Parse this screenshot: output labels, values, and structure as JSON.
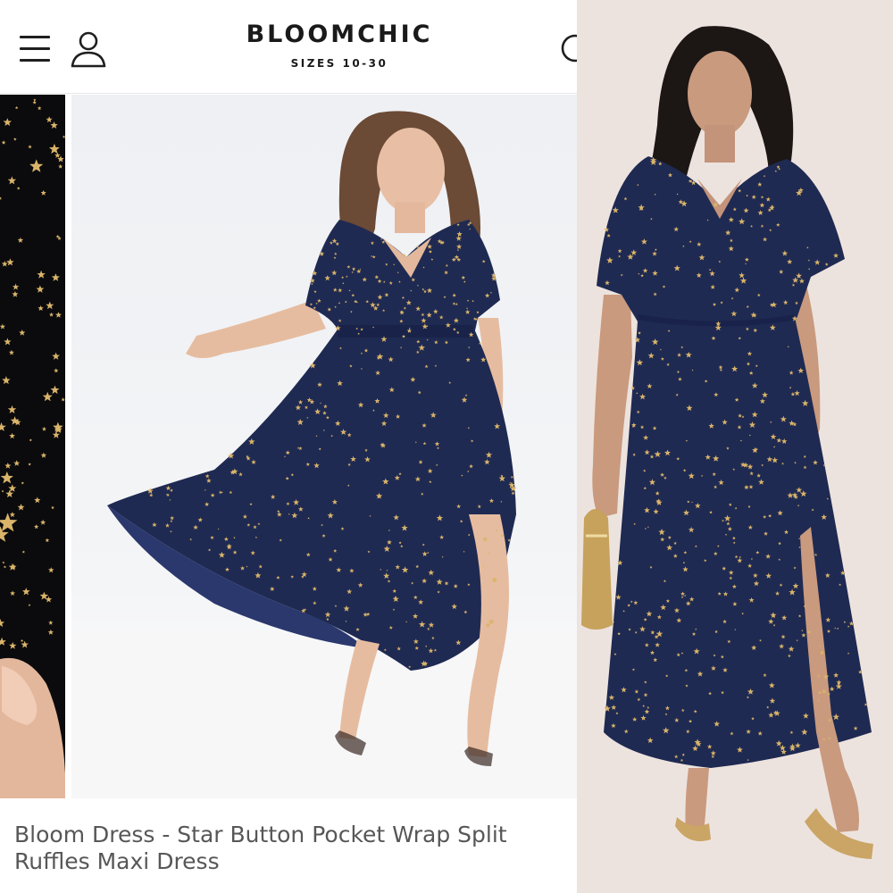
{
  "header": {
    "brand_name": "BLOOMCHIC",
    "brand_tagline": "SIZES 10-30",
    "menu_icon": "hamburger-menu-icon",
    "account_icon": "user-account-icon",
    "search_icon": "search-icon"
  },
  "gallery": {
    "thumbnail": "fabric-close-up-star-print",
    "main_image": "model-front-view-star-maxi-dress",
    "side_image": "model-front-view-star-maxi-dress-gold-bag"
  },
  "product": {
    "title": "Bloom Dress - Star Button Pocket Wrap Split Ruffles Maxi Dress"
  },
  "colors": {
    "dress_navy": "#1f2a52",
    "star_gold": "#d9b46a",
    "side_background": "#ede3de",
    "title_text": "#575757"
  }
}
